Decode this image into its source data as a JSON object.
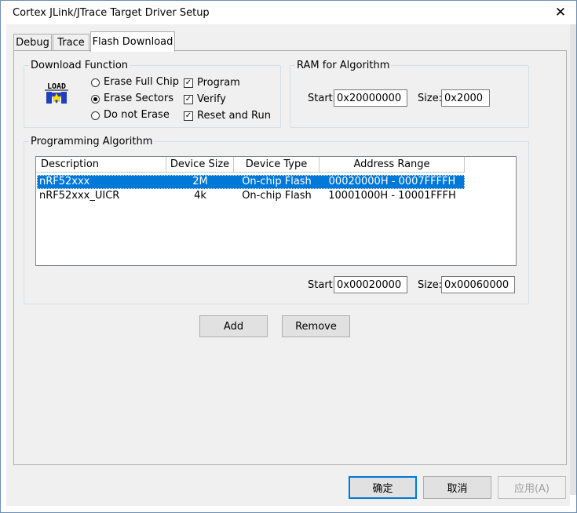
{
  "window": {
    "title": "Cortex JLink/JTrace Target Driver Setup"
  },
  "tabs": [
    {
      "label": "Debug"
    },
    {
      "label": "Trace"
    },
    {
      "label": "Flash Download",
      "active": true
    }
  ],
  "download_function": {
    "title": "Download Function",
    "icon_text": "LOAD",
    "erase_options": [
      {
        "label": "Erase Full Chip",
        "selected": false
      },
      {
        "label": "Erase Sectors",
        "selected": true
      },
      {
        "label": "Do not Erase",
        "selected": false
      }
    ],
    "checks": [
      {
        "label": "Program",
        "checked": true,
        "mark": "✓"
      },
      {
        "label": "Verify",
        "checked": true,
        "mark": "✓"
      },
      {
        "label": "Reset and Run",
        "checked": true,
        "mark": "✓"
      }
    ]
  },
  "ram": {
    "title": "RAM for Algorithm",
    "start_label": "Start:",
    "start_value": "0x20000000",
    "size_label": "Size:",
    "size_value": "0x2000"
  },
  "programming": {
    "title": "Programming Algorithm",
    "columns": [
      "Description",
      "Device Size",
      "Device Type",
      "Address Range"
    ],
    "rows": [
      {
        "description": "nRF52xxx",
        "size": "2M",
        "type": "On-chip Flash",
        "range": "00020000H - 0007FFFFH",
        "selected": true
      },
      {
        "description": "nRF52xxx_UICR",
        "size": "4k",
        "type": "On-chip Flash",
        "range": "10001000H - 10001FFFH",
        "selected": false
      }
    ],
    "start_label": "Start:",
    "start_value": "0x00020000",
    "size_label": "Size:",
    "size_value": "0x00060000"
  },
  "buttons": {
    "add": "Add",
    "remove": "Remove",
    "ok": "确定",
    "cancel": "取消",
    "apply": "应用(A)"
  },
  "colors": {
    "selection": "#0078d7",
    "default_button_border": "#0078d7",
    "dialog_bg": "#f0f0f0"
  }
}
